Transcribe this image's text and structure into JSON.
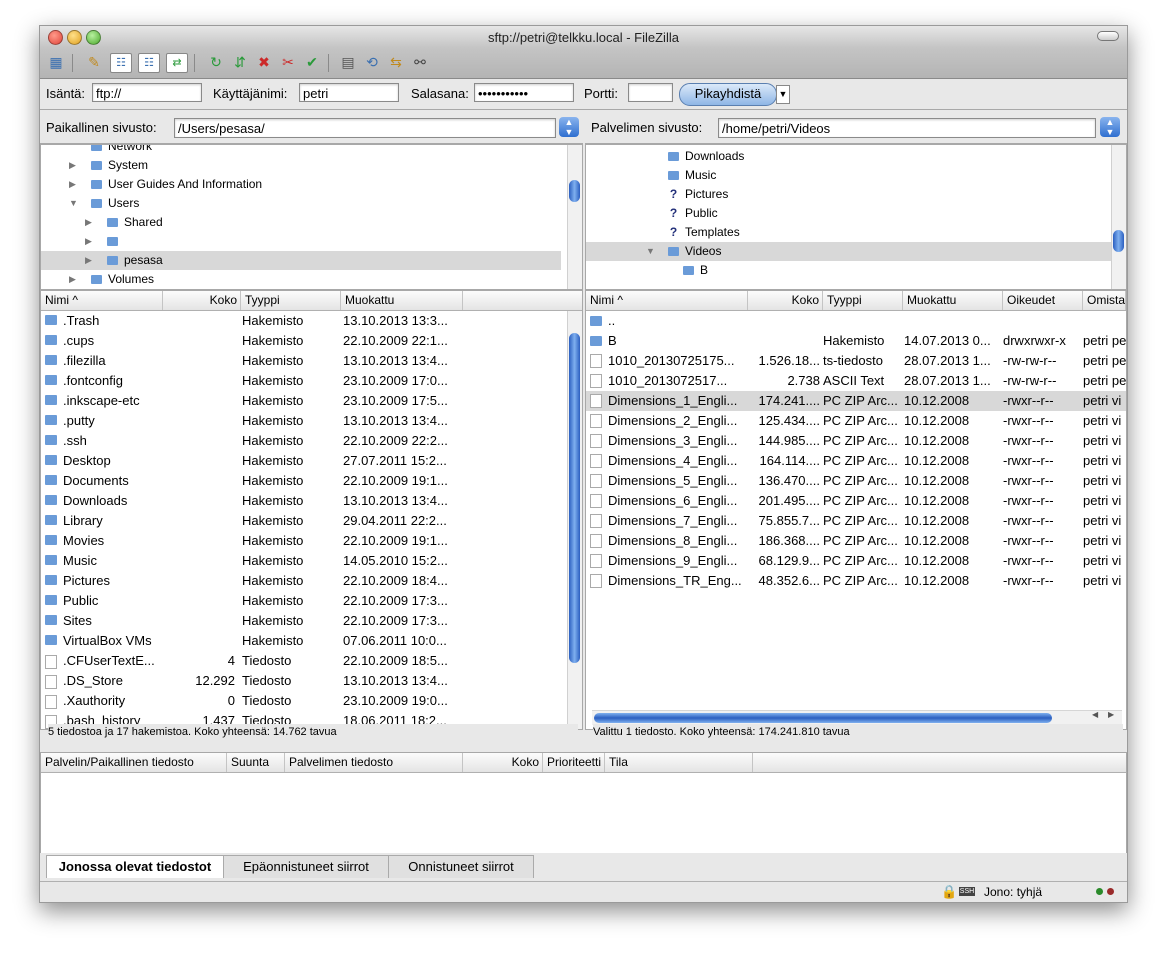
{
  "window": {
    "title": "sftp://petri@telkku.local - FileZilla"
  },
  "quickconnect": {
    "host_label": "Isäntä:",
    "host_value": "ftp://",
    "user_label": "Käyttäjänimi:",
    "user_value": "petri",
    "pass_label": "Salasana:",
    "pass_value": "•••••••••••",
    "port_label": "Portti:",
    "port_value": "",
    "connect_label": "Pikayhdistä"
  },
  "local": {
    "site_label": "Paikallinen sivusto:",
    "path": "/Users/pesasa/",
    "tree": [
      {
        "name": "Network",
        "icon": "folder-icon"
      },
      {
        "name": "System",
        "icon": "folder-icon"
      },
      {
        "name": "User Guides And Information",
        "icon": "folder-icon"
      },
      {
        "name": "Users",
        "icon": "folder-icon"
      },
      {
        "name": "Shared",
        "icon": "folder-icon"
      },
      {
        "name": "",
        "icon": "folder-icon"
      },
      {
        "name": "pesasa",
        "icon": "folder-icon"
      },
      {
        "name": "Volumes",
        "icon": "folder-icon"
      }
    ],
    "columns": {
      "name": "Nimi ^",
      "size": "Koko",
      "type": "Tyyppi",
      "modified": "Muokattu"
    },
    "files": [
      {
        "name": ".Trash",
        "size": "",
        "type": "Hakemisto",
        "modified": "13.10.2013 13:3...",
        "icon": "folder"
      },
      {
        "name": ".cups",
        "size": "",
        "type": "Hakemisto",
        "modified": "22.10.2009 22:1...",
        "icon": "folder"
      },
      {
        "name": ".filezilla",
        "size": "",
        "type": "Hakemisto",
        "modified": "13.10.2013 13:4...",
        "icon": "folder"
      },
      {
        "name": ".fontconfig",
        "size": "",
        "type": "Hakemisto",
        "modified": "23.10.2009 17:0...",
        "icon": "folder"
      },
      {
        "name": ".inkscape-etc",
        "size": "",
        "type": "Hakemisto",
        "modified": "23.10.2009 17:5...",
        "icon": "folder"
      },
      {
        "name": ".putty",
        "size": "",
        "type": "Hakemisto",
        "modified": "13.10.2013 13:4...",
        "icon": "folder"
      },
      {
        "name": ".ssh",
        "size": "",
        "type": "Hakemisto",
        "modified": "22.10.2009 22:2...",
        "icon": "folder"
      },
      {
        "name": "Desktop",
        "size": "",
        "type": "Hakemisto",
        "modified": "27.07.2011 15:2...",
        "icon": "folder"
      },
      {
        "name": "Documents",
        "size": "",
        "type": "Hakemisto",
        "modified": "22.10.2009 19:1...",
        "icon": "folder"
      },
      {
        "name": "Downloads",
        "size": "",
        "type": "Hakemisto",
        "modified": "13.10.2013 13:4...",
        "icon": "folder"
      },
      {
        "name": "Library",
        "size": "",
        "type": "Hakemisto",
        "modified": "29.04.2011 22:2...",
        "icon": "folder"
      },
      {
        "name": "Movies",
        "size": "",
        "type": "Hakemisto",
        "modified": "22.10.2009 19:1...",
        "icon": "folder"
      },
      {
        "name": "Music",
        "size": "",
        "type": "Hakemisto",
        "modified": "14.05.2010 15:2...",
        "icon": "folder"
      },
      {
        "name": "Pictures",
        "size": "",
        "type": "Hakemisto",
        "modified": "22.10.2009 18:4...",
        "icon": "folder"
      },
      {
        "name": "Public",
        "size": "",
        "type": "Hakemisto",
        "modified": "22.10.2009 17:3...",
        "icon": "folder"
      },
      {
        "name": "Sites",
        "size": "",
        "type": "Hakemisto",
        "modified": "22.10.2009 17:3...",
        "icon": "folder"
      },
      {
        "name": "VirtualBox VMs",
        "size": "",
        "type": "Hakemisto",
        "modified": "07.06.2011 10:0...",
        "icon": "folder"
      },
      {
        "name": ".CFUserTextE...",
        "size": "4",
        "type": "Tiedosto",
        "modified": "22.10.2009 18:5...",
        "icon": "file"
      },
      {
        "name": ".DS_Store",
        "size": "12.292",
        "type": "Tiedosto",
        "modified": "13.10.2013 13:4...",
        "icon": "file"
      },
      {
        "name": ".Xauthority",
        "size": "0",
        "type": "Tiedosto",
        "modified": "23.10.2009 19:0...",
        "icon": "file"
      },
      {
        "name": ".bash_history",
        "size": "1.437",
        "type": "Tiedosto",
        "modified": "18.06.2011 18:2...",
        "icon": "file"
      }
    ],
    "status": "5 tiedostoa ja 17 hakemistoa. Koko yhteensä: 14.762 tavua"
  },
  "remote": {
    "site_label": "Palvelimen sivusto:",
    "path": "/home/petri/Videos",
    "tree": [
      {
        "name": "Downloads",
        "icon": "folder-icon"
      },
      {
        "name": "Music",
        "icon": "folder-icon"
      },
      {
        "name": "Pictures",
        "icon": "question-icon"
      },
      {
        "name": "Public",
        "icon": "question-icon"
      },
      {
        "name": "Templates",
        "icon": "question-icon"
      },
      {
        "name": "Videos",
        "icon": "folder-icon"
      },
      {
        "name": "B",
        "icon": "folder-icon"
      }
    ],
    "columns": {
      "name": "Nimi ^",
      "size": "Koko",
      "type": "Tyyppi",
      "modified": "Muokattu",
      "perms": "Oikeudet",
      "owner": "Omista"
    },
    "files": [
      {
        "name": "..",
        "size": "",
        "type": "",
        "modified": "",
        "perms": "",
        "owner": "",
        "icon": "folder"
      },
      {
        "name": "B",
        "size": "",
        "type": "Hakemisto",
        "modified": "14.07.2013 0...",
        "perms": "drwxrwxr-x",
        "owner": "petri pe",
        "icon": "folder"
      },
      {
        "name": "1010_20130725175...",
        "size": "1.526.18...",
        "type": "ts-tiedosto",
        "modified": "28.07.2013 1...",
        "perms": "-rw-rw-r--",
        "owner": "petri pe",
        "icon": "file"
      },
      {
        "name": "1010_2013072517...",
        "size": "2.738",
        "type": "ASCII Text",
        "modified": "28.07.2013 1...",
        "perms": "-rw-rw-r--",
        "owner": "petri pe",
        "icon": "file"
      },
      {
        "name": "Dimensions_1_Engli...",
        "size": "174.241....",
        "type": "PC ZIP Arc...",
        "modified": "10.12.2008",
        "perms": "-rwxr--r--",
        "owner": "petri vi",
        "icon": "file"
      },
      {
        "name": "Dimensions_2_Engli...",
        "size": "125.434....",
        "type": "PC ZIP Arc...",
        "modified": "10.12.2008",
        "perms": "-rwxr--r--",
        "owner": "petri vi",
        "icon": "file"
      },
      {
        "name": "Dimensions_3_Engli...",
        "size": "144.985....",
        "type": "PC ZIP Arc...",
        "modified": "10.12.2008",
        "perms": "-rwxr--r--",
        "owner": "petri vi",
        "icon": "file"
      },
      {
        "name": "Dimensions_4_Engli...",
        "size": "164.114....",
        "type": "PC ZIP Arc...",
        "modified": "10.12.2008",
        "perms": "-rwxr--r--",
        "owner": "petri vi",
        "icon": "file"
      },
      {
        "name": "Dimensions_5_Engli...",
        "size": "136.470....",
        "type": "PC ZIP Arc...",
        "modified": "10.12.2008",
        "perms": "-rwxr--r--",
        "owner": "petri vi",
        "icon": "file"
      },
      {
        "name": "Dimensions_6_Engli...",
        "size": "201.495....",
        "type": "PC ZIP Arc...",
        "modified": "10.12.2008",
        "perms": "-rwxr--r--",
        "owner": "petri vi",
        "icon": "file"
      },
      {
        "name": "Dimensions_7_Engli...",
        "size": "75.855.7...",
        "type": "PC ZIP Arc...",
        "modified": "10.12.2008",
        "perms": "-rwxr--r--",
        "owner": "petri vi",
        "icon": "file"
      },
      {
        "name": "Dimensions_8_Engli...",
        "size": "186.368....",
        "type": "PC ZIP Arc...",
        "modified": "10.12.2008",
        "perms": "-rwxr--r--",
        "owner": "petri vi",
        "icon": "file"
      },
      {
        "name": "Dimensions_9_Engli...",
        "size": "68.129.9...",
        "type": "PC ZIP Arc...",
        "modified": "10.12.2008",
        "perms": "-rwxr--r--",
        "owner": "petri vi",
        "icon": "file"
      },
      {
        "name": "Dimensions_TR_Eng...",
        "size": "48.352.6...",
        "type": "PC ZIP Arc...",
        "modified": "10.12.2008",
        "perms": "-rwxr--r--",
        "owner": "petri vi",
        "icon": "file"
      }
    ],
    "status": "Valittu 1 tiedosto. Koko yhteensä: 174.241.810 tavua"
  },
  "queue": {
    "columns": {
      "file": "Palvelin/Paikallinen tiedosto",
      "direction": "Suunta",
      "remote": "Palvelimen tiedosto",
      "size": "Koko",
      "priority": "Prioriteetti",
      "state": "Tila"
    },
    "tabs": [
      "Jonossa olevat tiedostot",
      "Epäonnistuneet siirrot",
      "Onnistuneet siirrot"
    ],
    "status": "Jono: tyhjä"
  },
  "colors": {
    "selection": "#d8d8d8",
    "accent": "#2f6fd0"
  }
}
